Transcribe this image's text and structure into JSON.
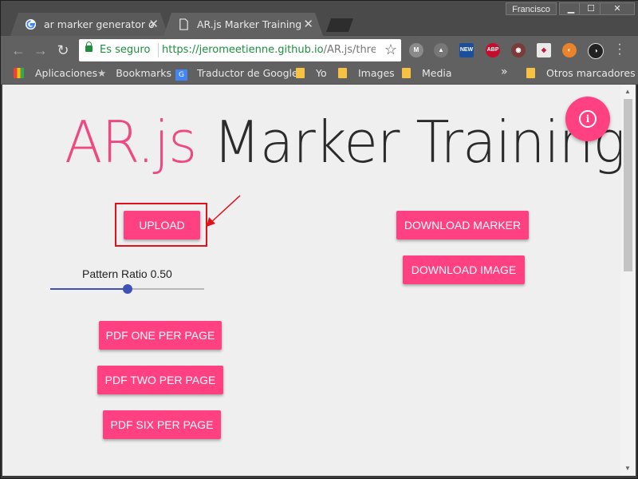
{
  "window": {
    "profile_name": "Francisco",
    "minimize": "▁",
    "maximize": "☐",
    "close": "✕"
  },
  "tabs": [
    {
      "title": "ar marker generator onlin",
      "icon": "google-icon",
      "active": false
    },
    {
      "title": "AR.js Marker Training",
      "icon": "page-icon",
      "active": true
    }
  ],
  "toolbar": {
    "back": "←",
    "forward": "→",
    "reload": "↻",
    "security_label": "Es seguro",
    "url_scheme": "https://",
    "url_host": "jeromeetienne.github.io",
    "url_path": "/AR.js/thre...",
    "star": "☆",
    "extensions": [
      {
        "name": "m-icon",
        "label": "M",
        "color": "#8a8a8a"
      },
      {
        "name": "drive-icon",
        "label": "▲",
        "color": "#777777"
      },
      {
        "name": "new-icon",
        "label": "NEW",
        "color": "#1b4f9c"
      },
      {
        "name": "adblock-icon",
        "label": "ABP",
        "color": "#c70d2c"
      },
      {
        "name": "eye-icon",
        "label": "◉",
        "color": "#7a3b3b"
      },
      {
        "name": "shield-icon",
        "label": "◈",
        "color": "#e9e9e9"
      },
      {
        "name": "avast-icon",
        "label": "◐",
        "color": "#e9842a"
      },
      {
        "name": "contrast-icon",
        "label": "◑",
        "color": "#222222"
      }
    ]
  },
  "bookmarks": {
    "items": [
      "Aplicaciones",
      "Bookmarks",
      "Traductor de Google",
      "Yo",
      "Images",
      "Media"
    ],
    "overflow": "»",
    "other": "Otros marcadores"
  },
  "page": {
    "title_accent": "AR.js",
    "title_rest": " Marker Training",
    "buttons": {
      "upload": "UPLOAD",
      "download_marker": "DOWNLOAD MARKER",
      "download_image": "DOWNLOAD IMAGE",
      "pdf_one": "PDF ONE PER PAGE",
      "pdf_two": "PDF TWO PER PAGE",
      "pdf_six": "PDF SIX PER PAGE"
    },
    "slider": {
      "label": "Pattern Ratio 0.50",
      "value": 0.5,
      "color": "#3f51b5"
    },
    "accent_color": "#ff4081"
  }
}
